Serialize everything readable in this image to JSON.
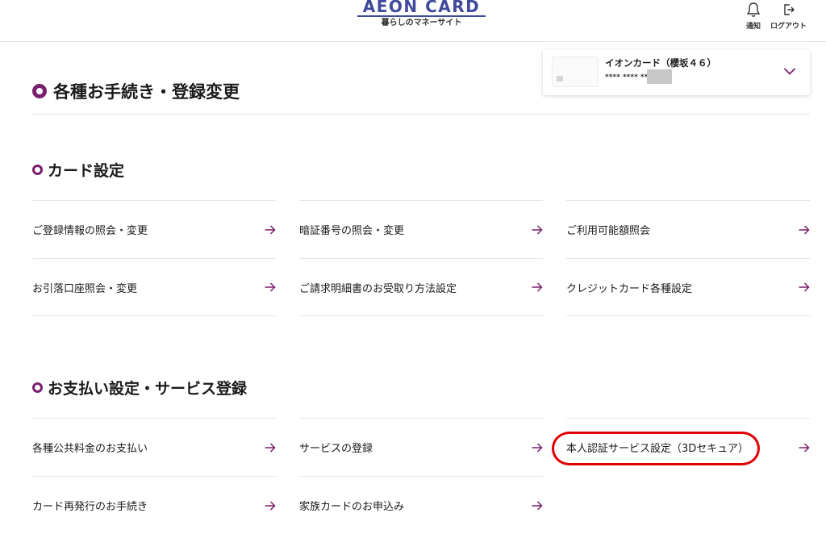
{
  "header": {
    "logo_main": "AEON CARD",
    "logo_sub": "暮らしのマネーサイト",
    "notification_label": "通知",
    "notification_icon": "bell-icon",
    "logout_label": "ログアウト",
    "logout_icon": "logout-icon"
  },
  "card_selector": {
    "card_name": "イオンカード（櫻坂４６）",
    "card_number": "**** **** ****",
    "toggle_icon": "chevron-down-icon"
  },
  "page_title": "各種お手続き・登録変更",
  "sections": [
    {
      "title": "カード設定",
      "items": [
        {
          "label": "ご登録情報の照会・変更"
        },
        {
          "label": "暗証番号の照会・変更"
        },
        {
          "label": "ご利用可能額照会"
        },
        {
          "label": "お引落口座照会・変更"
        },
        {
          "label": "ご請求明細書のお受取り方法設定"
        },
        {
          "label": "クレジットカード各種設定"
        }
      ]
    },
    {
      "title": "お支払い設定・サービス登録",
      "items": [
        {
          "label": "各種公共料金のお支払い"
        },
        {
          "label": "サービスの登録"
        },
        {
          "label": "本人認証サービス設定（3Dセキュア）"
        },
        {
          "label": "カード再発行のお手続き"
        },
        {
          "label": "家族カードのお申込み"
        }
      ]
    }
  ],
  "colors": {
    "brand": "#3f4a9c",
    "accent": "#7a1f6e",
    "highlight": "#e00000"
  }
}
